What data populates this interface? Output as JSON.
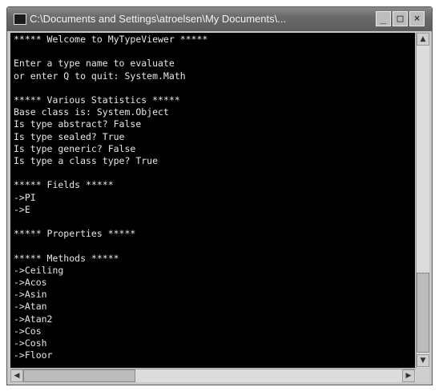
{
  "window": {
    "title": "C:\\Documents and Settings\\atroelsen\\My Documents\\...",
    "minimize_glyph": "_",
    "maximize_glyph": "□",
    "close_glyph": "×"
  },
  "console": {
    "lines": [
      "***** Welcome to MyTypeViewer *****",
      "",
      "Enter a type name to evaluate",
      "or enter Q to quit: System.Math",
      "",
      "***** Various Statistics *****",
      "Base class is: System.Object",
      "Is type abstract? False",
      "Is type sealed? True",
      "Is type generic? False",
      "Is type a class type? True",
      "",
      "***** Fields *****",
      "->PI",
      "->E",
      "",
      "***** Properties *****",
      "",
      "***** Methods *****",
      "->Ceiling",
      "->Acos",
      "->Asin",
      "->Atan",
      "->Atan2",
      "->Cos",
      "->Cosh",
      "->Floor"
    ]
  },
  "scrollbars": {
    "up_glyph": "▲",
    "down_glyph": "▼",
    "left_glyph": "◀",
    "right_glyph": "▶"
  }
}
